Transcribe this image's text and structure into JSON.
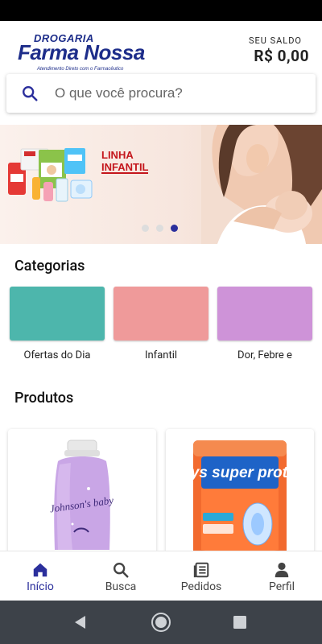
{
  "app": {
    "logo_line1": "DROGARIA",
    "logo_line2": "Farma Nossa",
    "logo_tagline": "Atendimento Direto com o Farmacêutico"
  },
  "balance": {
    "label": "SEU SALDO",
    "value": "R$ 0,00"
  },
  "search": {
    "placeholder": "O que você procura?"
  },
  "banner": {
    "title_line1": "LINHA",
    "title_line2": "INFANTIL",
    "active_slide": 3,
    "total_slides": 3
  },
  "categories": {
    "title": "Categorias",
    "items": [
      {
        "label": "Ofertas do Dia",
        "color": "#4db6ac"
      },
      {
        "label": "Infantil",
        "color": "#ef9a9a"
      },
      {
        "label": "Dor, Febre e",
        "color": "#ce93d8"
      }
    ]
  },
  "products": {
    "title": "Produtos",
    "items": [
      {
        "label": "Johnson's baby"
      },
      {
        "label": "always super proteção"
      }
    ]
  },
  "bottom_nav": {
    "items": [
      {
        "label": "Início",
        "icon": "home-icon",
        "active": true
      },
      {
        "label": "Busca",
        "icon": "search-icon",
        "active": false
      },
      {
        "label": "Pedidos",
        "icon": "orders-icon",
        "active": false
      },
      {
        "label": "Perfil",
        "icon": "profile-icon",
        "active": false
      }
    ]
  },
  "colors": {
    "accent": "#2b2f9c",
    "brand": "#1d2d8a"
  }
}
